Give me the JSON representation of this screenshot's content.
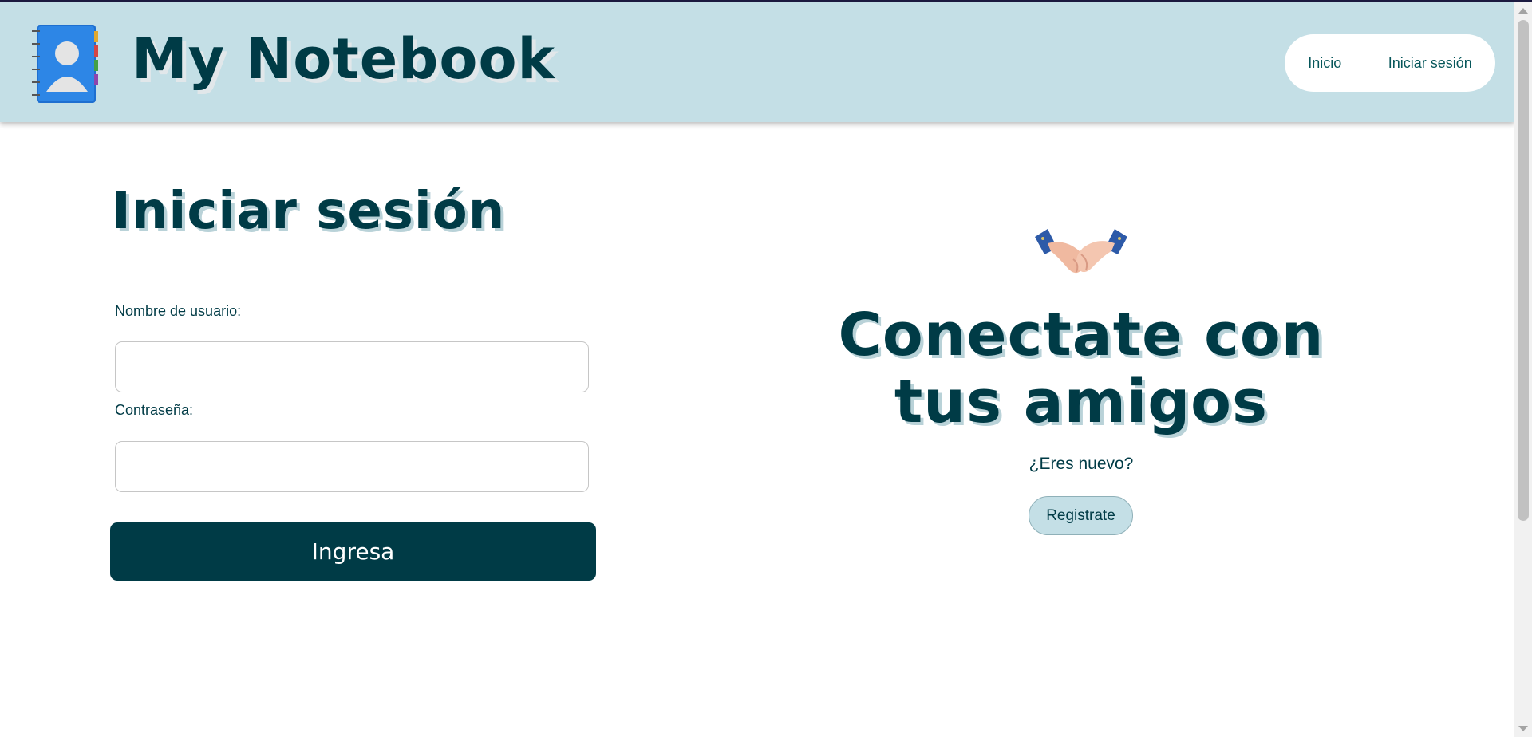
{
  "header": {
    "brand": "My Notebook",
    "logo_icon": "notebook-contact-icon",
    "nav": [
      "Inicio",
      "Iniciar sesión"
    ]
  },
  "login": {
    "title": "Iniciar sesión",
    "username_label": "Nombre de usuario:",
    "username_value": "",
    "password_label": "Contraseña:",
    "password_value": "",
    "submit_label": "Ingresa"
  },
  "promo": {
    "icon": "handshake-icon",
    "title": "Conectate con tus amigos",
    "question": "¿Eres nuevo?",
    "register_label": "Registrate"
  },
  "colors": {
    "header_bg": "#c4dfe6",
    "primary": "#003b46",
    "link": "#07575b"
  }
}
